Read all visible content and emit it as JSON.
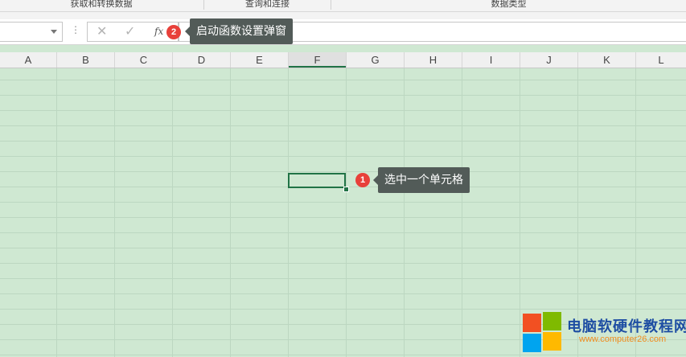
{
  "ribbon": {
    "groups": [
      "获取和转换数据",
      "查询和连接",
      "数据类型"
    ]
  },
  "formula_bar": {
    "namebox_value": "",
    "formula_value": "",
    "cancel_glyph": "✕",
    "enter_glyph": "✓",
    "fx_label": "fx",
    "more_glyph": "⋮"
  },
  "annotations": {
    "step2": {
      "number": "2",
      "text": "启动函数设置弹窗"
    },
    "step1": {
      "number": "1",
      "text": "选中一个单元格"
    }
  },
  "columns": [
    "A",
    "B",
    "C",
    "D",
    "E",
    "F",
    "G",
    "H",
    "I",
    "J",
    "K",
    "L"
  ],
  "selected_column": "F",
  "watermark": {
    "title": "电脑软硬件教程网",
    "url": "www.computer26.com",
    "logo_colors": [
      "#f25022",
      "#7fba00",
      "#00a4ef",
      "#ffb900"
    ]
  },
  "colors": {
    "sheet_background": "#cfe8d2",
    "accent": "#217346",
    "badge": "#e8403a",
    "tooltip": "#525b58"
  }
}
